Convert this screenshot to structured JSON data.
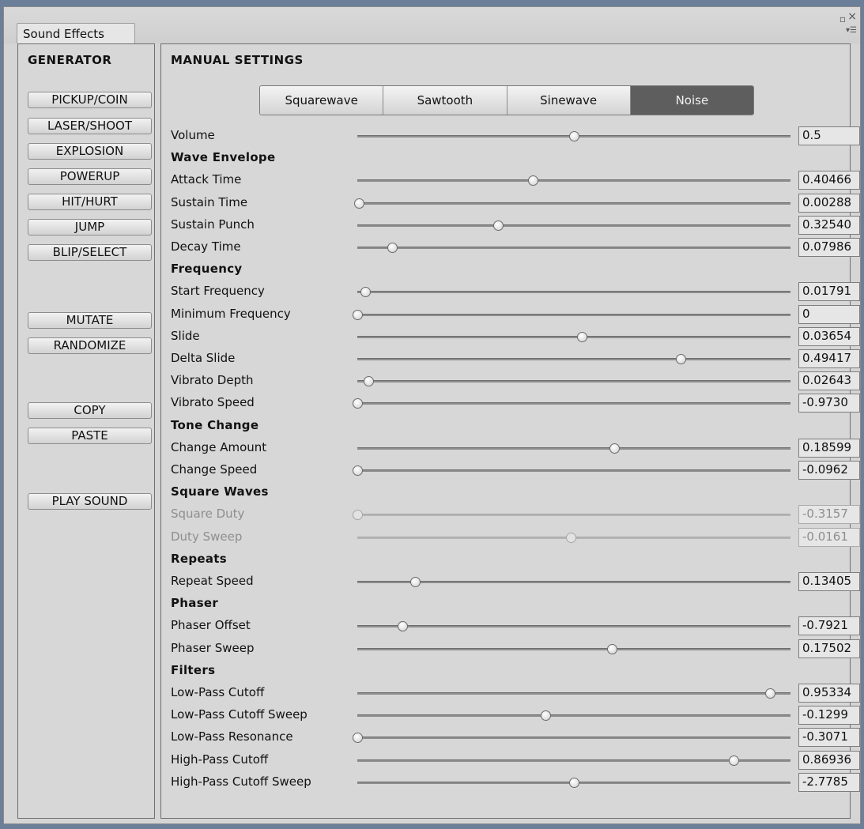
{
  "window": {
    "tab_label": "Sound Effects",
    "controls": [
      "▫",
      "×"
    ]
  },
  "generator": {
    "title": "GENERATOR",
    "buttons": [
      {
        "label": "PICKUP/COIN"
      },
      {
        "label": "LASER/SHOOT"
      },
      {
        "label": "EXPLOSION"
      },
      {
        "label": "POWERUP"
      },
      {
        "label": "HIT/HURT"
      },
      {
        "label": "JUMP"
      },
      {
        "label": "BLIP/SELECT"
      },
      {
        "label": "MUTATE"
      },
      {
        "label": "RANDOMIZE"
      },
      {
        "label": "COPY"
      },
      {
        "label": "PASTE"
      },
      {
        "label": "PLAY SOUND"
      }
    ]
  },
  "manual": {
    "title": "MANUAL SETTINGS",
    "wave_types": [
      "Squarewave",
      "Sawtooth",
      "Sinewave",
      "Noise"
    ],
    "selected_wave": "Noise",
    "volume": {
      "label": "Volume",
      "value": "0.5",
      "slider": 0.5
    },
    "groups": [
      {
        "heading": "Wave Envelope",
        "params": [
          {
            "label": "Attack Time",
            "value": "0.40466",
            "slider": 0.405
          },
          {
            "label": "Sustain Time",
            "value": "0.00288",
            "slider": 0.003
          },
          {
            "label": "Sustain Punch",
            "value": "0.32540",
            "slider": 0.325
          },
          {
            "label": "Decay Time",
            "value": "0.07986",
            "slider": 0.08
          }
        ]
      },
      {
        "heading": "Frequency",
        "params": [
          {
            "label": "Start Frequency",
            "value": "0.01791",
            "slider": 0.018
          },
          {
            "label": "Minimum Frequency",
            "value": "0",
            "slider": 0
          },
          {
            "label": "Slide",
            "value": "0.03654",
            "slider": 0.518
          },
          {
            "label": "Delta Slide",
            "value": "0.49417",
            "slider": 0.747
          },
          {
            "label": "Vibrato Depth",
            "value": "0.02643",
            "slider": 0.026
          },
          {
            "label": "Vibrato Speed",
            "value": "-0.9730",
            "slider": 0
          }
        ]
      },
      {
        "heading": "Tone Change",
        "params": [
          {
            "label": "Change Amount",
            "value": "0.18599",
            "slider": 0.593
          },
          {
            "label": "Change Speed",
            "value": "-0.0962",
            "slider": 0
          }
        ]
      },
      {
        "heading": "Square Waves",
        "params": [
          {
            "label": "Square Duty",
            "value": "-0.3157",
            "slider": 0,
            "disabled": true
          },
          {
            "label": "Duty Sweep",
            "value": "-0.0161",
            "slider": 0.492,
            "disabled": true
          }
        ]
      },
      {
        "heading": "Repeats",
        "params": [
          {
            "label": "Repeat Speed",
            "value": "0.13405",
            "slider": 0.134
          }
        ]
      },
      {
        "heading": "Phaser",
        "params": [
          {
            "label": "Phaser Offset",
            "value": "-0.7921",
            "slider": 0.104
          },
          {
            "label": "Phaser Sweep",
            "value": "0.17502",
            "slider": 0.588
          }
        ]
      },
      {
        "heading": "Filters",
        "params": [
          {
            "label": "Low-Pass Cutoff",
            "value": "0.95334",
            "slider": 0.953
          },
          {
            "label": "Low-Pass Cutoff Sweep",
            "value": "-0.1299",
            "slider": 0.435
          },
          {
            "label": "Low-Pass Resonance",
            "value": "-0.3071",
            "slider": 0
          },
          {
            "label": "High-Pass Cutoff",
            "value": "0.86936",
            "slider": 0.869
          },
          {
            "label": "High-Pass Cutoff Sweep",
            "value": "-2.7785",
            "slider": 0.5
          }
        ]
      }
    ]
  }
}
